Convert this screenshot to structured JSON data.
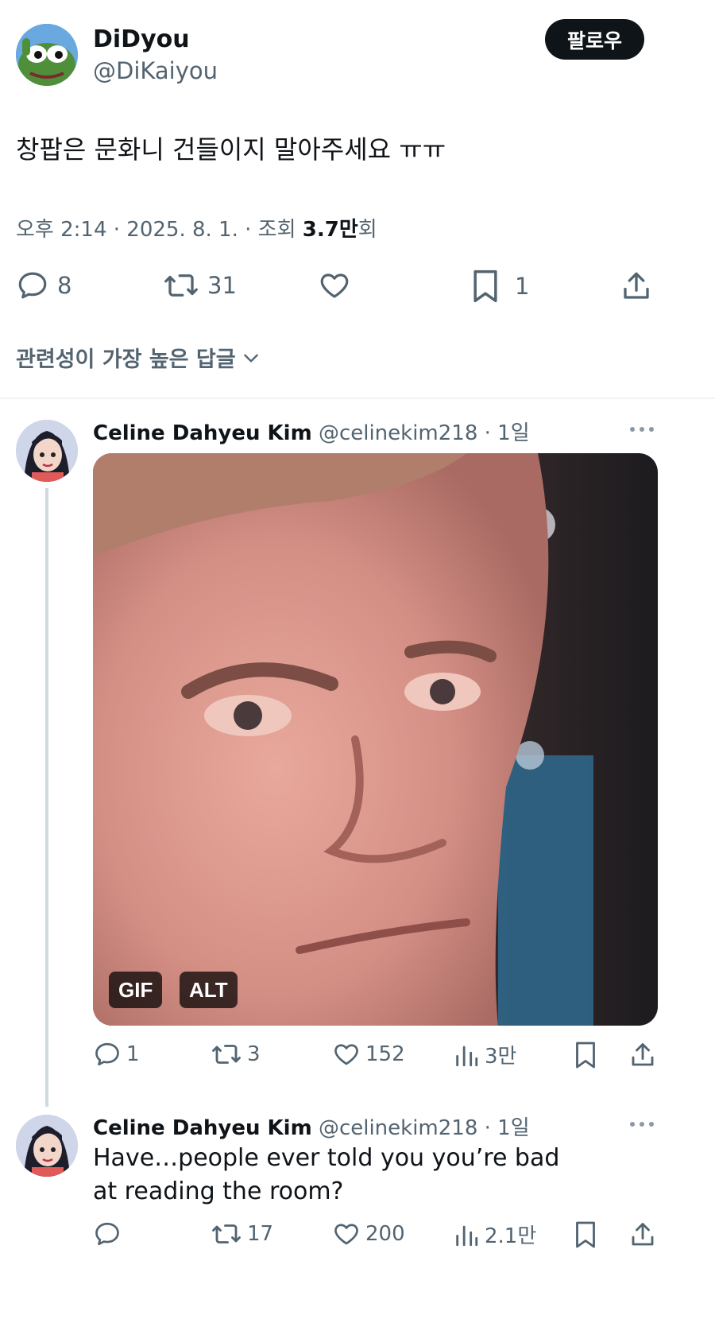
{
  "tweet": {
    "display_name": "DiDyou",
    "handle": "@DiKaiyou",
    "follow_label": "팔로우",
    "text": "창팝은 문화니 건들이지 말아주세요 ㅠㅠ",
    "meta_prefix": "오후 2:14 · 2025. 8. 1. · 조회 ",
    "views_count": "3.7만",
    "views_suffix": "회",
    "stats": {
      "replies": "8",
      "retweets": "31",
      "likes": "",
      "bookmarks": "1"
    }
  },
  "replies_sort": {
    "label": "관련성이 가장 높은 답글"
  },
  "replies": [
    {
      "name": "Celine Dahyeu Kim",
      "handle": "@celinekim218",
      "time": " · 1일",
      "media_badges": [
        "GIF",
        "ALT"
      ],
      "stats": {
        "replies": "1",
        "retweets": "3",
        "likes": "152",
        "views": "3만"
      }
    },
    {
      "name": "Celine Dahyeu Kim",
      "handle": "@celinekim218",
      "time": " · 1일",
      "text": "Have…people ever told you you’re bad at reading the room?",
      "stats": {
        "replies": "",
        "retweets": "17",
        "likes": "200",
        "views": "2.1만"
      }
    }
  ],
  "colors": {
    "text": "#0f1419",
    "muted": "#536471",
    "button_bg": "#0f1419",
    "divider": "#eff3f4"
  }
}
